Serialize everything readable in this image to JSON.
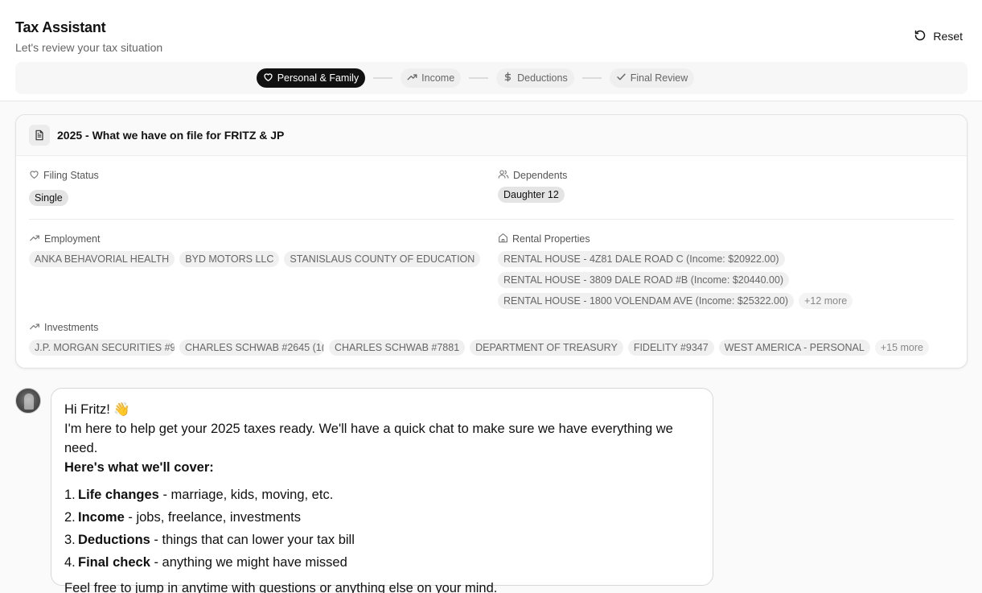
{
  "header": {
    "title": "Tax Assistant",
    "subtitle": "Let's review your tax situation",
    "reset_label": "Reset"
  },
  "steps": [
    {
      "label": "Personal & Family",
      "icon": "heart-icon",
      "active": true
    },
    {
      "label": "Income",
      "icon": "trending-up-icon",
      "active": false
    },
    {
      "label": "Deductions",
      "icon": "dollar-icon",
      "active": false
    },
    {
      "label": "Final Review",
      "icon": "check-icon",
      "active": false
    }
  ],
  "file_card": {
    "title": "2025 - What we have on file for FRITZ & JP",
    "filing_status": {
      "label": "Filing Status",
      "value": "Single"
    },
    "dependents": {
      "label": "Dependents",
      "items": [
        "Daughter 12"
      ]
    },
    "employment": {
      "label": "Employment",
      "items": [
        "ANKA BEHAVORIAL HEALTH",
        "BYD MOTORS LLC",
        "STANISLAUS COUNTY OF EDUCATION"
      ]
    },
    "rental_properties": {
      "label": "Rental Properties",
      "items": [
        "RENTAL HOUSE - 4Z81 DALE ROAD C (Income: $20922.00)",
        "RENTAL HOUSE - 3809 DALE ROAD #B (Income: $20440.00)",
        "RENTAL HOUSE - 1800 VOLENDAM AVE (Income: $25322.00)"
      ],
      "more": "+12 more"
    },
    "investments": {
      "label": "Investments",
      "items": [
        "J.P. MORGAN SECURITIES #9!",
        "CHARLES SCHWAB #2645 (1(",
        "CHARLES SCHWAB #7881",
        "DEPARTMENT OF TREASURY",
        "FIDELITY #9347",
        "WEST AMERICA - PERSONAL"
      ],
      "more": "+15 more"
    }
  },
  "message": {
    "greeting": "Hi Fritz! 👋",
    "intro": "I'm here to help get your 2025 taxes ready. We'll have a quick chat to make sure we have everything we need.",
    "cover_heading": "Here's what we'll cover:",
    "items": [
      {
        "num": "1.",
        "title": "Life changes",
        "desc": " - marriage, kids, moving, etc."
      },
      {
        "num": "2.",
        "title": "Income",
        "desc": " - jobs, freelance, investments"
      },
      {
        "num": "3.",
        "title": "Deductions",
        "desc": " - things that can lower your tax bill"
      },
      {
        "num": "4.",
        "title": "Final check",
        "desc": " - anything we might have missed"
      }
    ],
    "footer": "Feel free to jump in anytime with questions or anything else on your mind."
  }
}
